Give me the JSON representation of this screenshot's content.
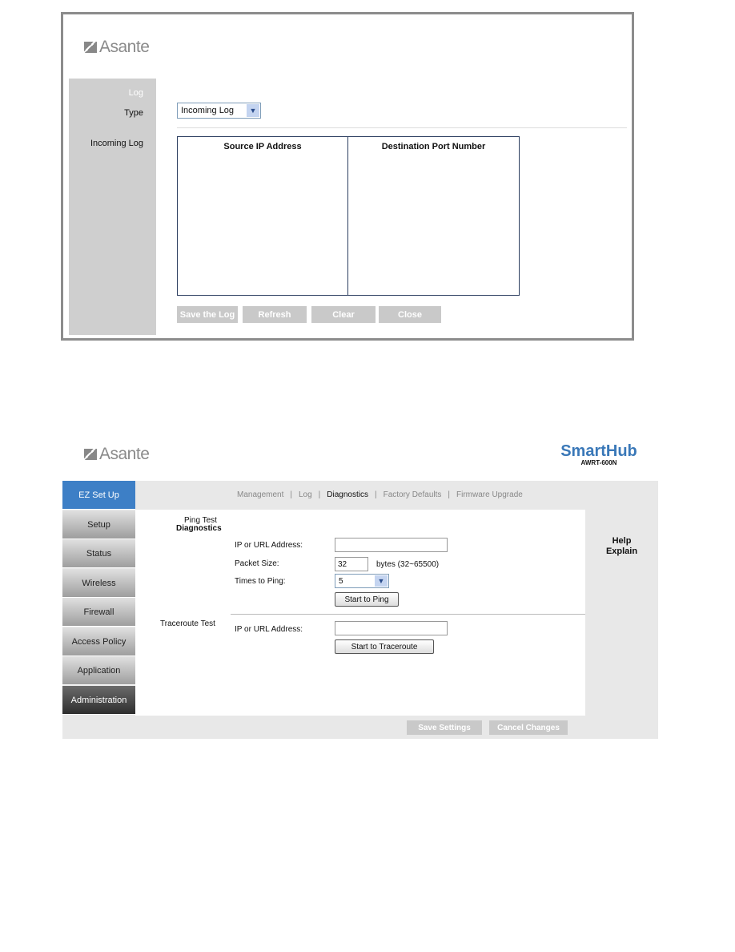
{
  "log_panel": {
    "logo": "Asante",
    "sidebar": {
      "section": "Log",
      "type_label": "Type",
      "incoming_label": "Incoming Log"
    },
    "type_select": {
      "value": "Incoming Log"
    },
    "table": {
      "headers": [
        "Source IP Address",
        "Destination Port Number"
      ],
      "rows": []
    },
    "buttons": [
      "Save the Log",
      "Refresh",
      "Clear",
      "Close"
    ]
  },
  "diag_panel": {
    "logo": "Asante",
    "brand": {
      "name": "SmartHub",
      "model": "AWRT-600N",
      "color": "#3a78b8"
    },
    "sidebar": [
      "EZ Set Up",
      "Setup",
      "Status",
      "Wireless",
      "Firewall",
      "Access Policy",
      "Application",
      "Administration"
    ],
    "active_color": "#3d7fc6",
    "subnav": [
      "Management",
      "Log",
      "Diagnostics",
      "Factory Defaults",
      "Firmware Upgrade"
    ],
    "subnav_active": "Diagnostics",
    "title": "Diagnostics",
    "ping": {
      "section": "Ping Test",
      "ip_label": "IP or URL Address:",
      "ip_value": "",
      "size_label": "Packet Size:",
      "size_value": "32",
      "size_hint": "bytes (32~65500)",
      "times_label": "Times to Ping:",
      "times_value": "5",
      "button": "Start to Ping"
    },
    "traceroute": {
      "section": "Traceroute Test",
      "ip_label": "IP or URL Address:",
      "ip_value": "",
      "button": "Start to Traceroute"
    },
    "help": {
      "line1": "Help",
      "line2": "Explain"
    },
    "footer": {
      "save": "Save Settings",
      "cancel": "Cancel Changes"
    }
  }
}
